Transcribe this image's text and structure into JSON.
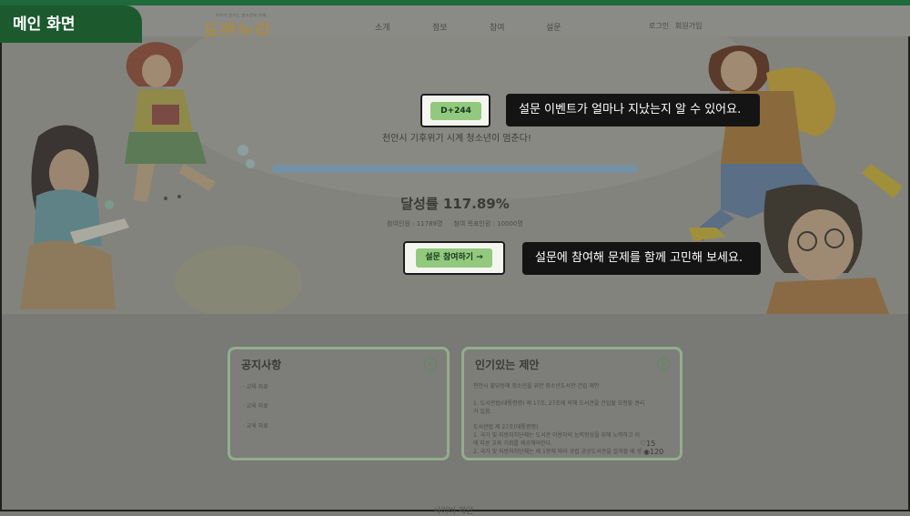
{
  "tag": {
    "label": "메인 화면"
  },
  "nav": {
    "logo_small": "우리가 만드는 청소년의 미래",
    "logo": "도란누리",
    "items": [
      "소개",
      "정보",
      "참여",
      "설문"
    ],
    "login": "로그인",
    "signup": "회원가입"
  },
  "hero": {
    "dday": "D+244",
    "dday_callout": "설문 이벤트가 얼마나 지났는지 알 수 있어요.",
    "challenge": "천안시 기후위기 시계 청소년이 멈춘다!",
    "progress_fraction": 1.0,
    "rate": "달성률 117.89%",
    "participants": "참여인원 : 11789명",
    "target": "참여 목표인원 : 10000명",
    "cta": "설문 참여하기 →",
    "cta_callout": "설문에 참여해 문제를 함께 고민해 보세요."
  },
  "notice": {
    "title": "공지사항",
    "items": [
      "교육 자료",
      "교육 자료",
      "교육 자료"
    ]
  },
  "proposal": {
    "title": "인기있는 제안",
    "lines": [
      "천안시 불당동에 청소년을 위한 청소년도서관 건립 제안",
      "1. 도서관법(대통령령) 제 17조, 27조에 의해 도서관을 건립할 요청할 권리",
      "가 있음.",
      "도서관법 제 27조(대통령령)",
      "1. 국가 및 지방자치단체는 도서관 이용자의 능력향상을 위해 노력하고 이",
      "에 따른 교육 기회를 제공해야한다.",
      "2. 국가 및 지방자치단체는 제 1항에 따라 공립 공공도서관을 설치할 때 생"
    ],
    "likes": "15",
    "views": "120"
  },
  "next_section": "사이버 제안"
}
